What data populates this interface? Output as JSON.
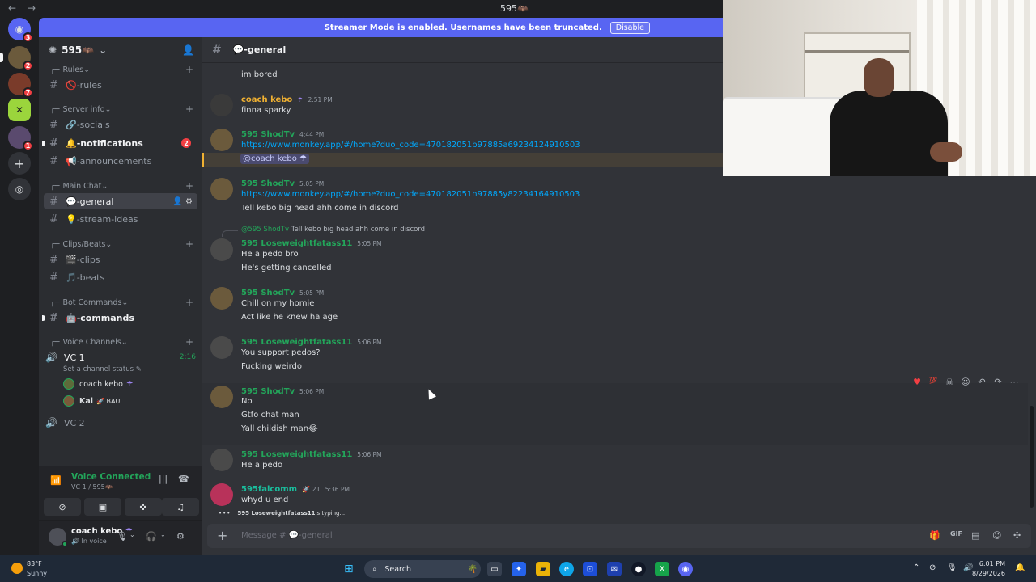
{
  "titlebar": {
    "title": "595🦇",
    "back": "←",
    "forward": "→"
  },
  "banner": {
    "text": "Streamer Mode is enabled. Usernames have been truncated.",
    "button": "Disable"
  },
  "rail": {
    "home_badge": "3",
    "servers": [
      {
        "badge": "2"
      },
      {
        "badge": "7"
      },
      {
        "badge": ""
      },
      {
        "badge": "1"
      }
    ]
  },
  "server": {
    "name": "595🦇",
    "chevron": "⌄"
  },
  "sidebar": {
    "categories": {
      "rules": "Rules",
      "server_info": "Server info",
      "main_chat": "Main Chat",
      "clips_beats": "Clips/Beats",
      "bot_commands": "Bot Commands",
      "voice_channels": "Voice Channels"
    },
    "channels": {
      "rules": "🚫-rules",
      "socials": "🔗-socials",
      "notifications": "🔔-notifications",
      "notifications_badge": "2",
      "announcements": "📢-announcements",
      "general": "💬-general",
      "stream_ideas": "💡-stream-ideas",
      "clips": "🎬-clips",
      "beats": "🎵-beats",
      "commands": "🤖-commands"
    },
    "voice": {
      "vc1": "VC 1",
      "vc1_time": "2:16",
      "status_prompt": "Set a channel status ✎",
      "users": [
        "coach kebo",
        "Kal"
      ],
      "user_badges": [
        "☂",
        "🚀 BAU"
      ],
      "vc2": "VC 2"
    }
  },
  "voice_panel": {
    "title": "Voice Connected",
    "subtitle": "VC 1 / 595🦇"
  },
  "user_panel": {
    "name": "coach kebo",
    "badge": "☂",
    "status": "In voice"
  },
  "chat": {
    "channel": "💬-general",
    "messages": [
      {
        "lines": [
          "im bored"
        ]
      },
      {
        "author": "coach kebo",
        "tag": "☂",
        "time": "2:51 PM",
        "lines": [
          "finna sparky"
        ]
      },
      {
        "author": "595 ShodTv",
        "time": "4:44 PM",
        "link": "https://www.monkey.app/#/home?duo_code=470182051b97885a69234124910503",
        "mention": "@coach kebo ☂"
      },
      {
        "author": "595 ShodTv",
        "time": "5:05 PM",
        "link": "https://www.monkey.app/#/home?duo_code=470182051n97885y82234164910503",
        "lines": [
          "Tell kebo big head ahh come in discord"
        ]
      },
      {
        "reply_author": "@595 ShodTv",
        "reply_text": "Tell kebo big head ahh come in discord",
        "author": "595 Loseweightfatass11",
        "time": "5:05 PM",
        "lines": [
          "He a pedo bro",
          "He's getting cancelled"
        ]
      },
      {
        "author": "595 ShodTv",
        "time": "5:05 PM",
        "lines": [
          "Chill on my homie",
          "Act like he knew ha age"
        ]
      },
      {
        "author": "595 Loseweightfatass11",
        "time": "5:06 PM",
        "lines": [
          "You support pedos?",
          "Fucking weirdo"
        ]
      },
      {
        "author": "595 ShodTv",
        "time": "5:06 PM",
        "lines": [
          "No",
          "Gtfo chat man",
          "Yall childish man😂"
        ]
      },
      {
        "author": "595 Loseweightfatass11",
        "time": "5:06 PM",
        "lines": [
          "He a pedo"
        ]
      },
      {
        "author": "595falcomm",
        "tag": "🚀 21",
        "time": "5:36 PM",
        "lines": [
          "whyd u end"
        ]
      }
    ],
    "typing_user": "595 Loseweightfatass11",
    "typing_suffix": " is typing...",
    "composer_placeholder": "Message # 💬-general"
  },
  "taskbar": {
    "temperature": "83°F",
    "condition": "Sunny",
    "search": "Search",
    "time": "6:01 PM",
    "date": "8/29/2026"
  },
  "colors": {
    "accent": "#5865f2",
    "online": "#23a55a",
    "link": "#00a8fc",
    "mention_highlight": "#f0b132",
    "danger": "#f23f43"
  }
}
